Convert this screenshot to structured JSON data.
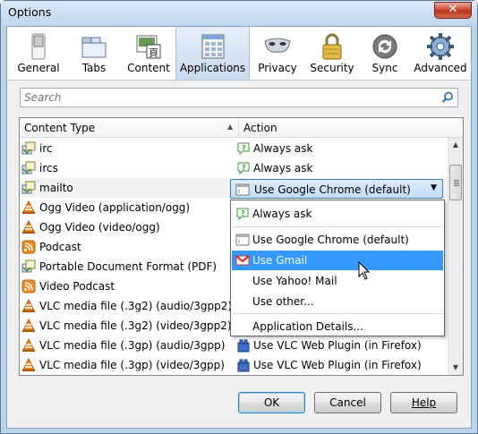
{
  "window": {
    "title": "Options",
    "close_glyph": "✕"
  },
  "toolbar": {
    "panes": [
      {
        "label": "General",
        "icon": "switch-icon"
      },
      {
        "label": "Tabs",
        "icon": "tabs-icon"
      },
      {
        "label": "Content",
        "icon": "content-icon"
      },
      {
        "label": "Applications",
        "icon": "applications-icon",
        "selected": true
      },
      {
        "label": "Privacy",
        "icon": "mask-icon"
      },
      {
        "label": "Security",
        "icon": "lock-icon"
      },
      {
        "label": "Sync",
        "icon": "sync-icon"
      },
      {
        "label": "Advanced",
        "icon": "gear-icon"
      }
    ]
  },
  "search": {
    "placeholder": "Search",
    "value": ""
  },
  "table": {
    "columns": {
      "content_type": "Content Type",
      "action": "Action",
      "sort_glyph": "▲"
    },
    "rows": [
      {
        "content_type": "irc",
        "ct_icon": "protocol-icon",
        "action": "Always ask",
        "ac_icon": "always-ask-icon"
      },
      {
        "content_type": "ircs",
        "ct_icon": "protocol-icon",
        "action": "Always ask",
        "ac_icon": "always-ask-icon"
      },
      {
        "content_type": "mailto",
        "ct_icon": "protocol-icon",
        "action": "Use Google Chrome (default)",
        "ac_icon": "app-window-icon",
        "selected": true
      },
      {
        "content_type": "Ogg Video (application/ogg)",
        "ct_icon": "vlc-cone-icon",
        "action": "",
        "ac_icon": ""
      },
      {
        "content_type": "Ogg Video (video/ogg)",
        "ct_icon": "vlc-cone-icon",
        "action": "",
        "ac_icon": ""
      },
      {
        "content_type": "Podcast",
        "ct_icon": "feed-icon",
        "action": "",
        "ac_icon": ""
      },
      {
        "content_type": "Portable Document Format (PDF)",
        "ct_icon": "protocol-icon",
        "action": "",
        "ac_icon": ""
      },
      {
        "content_type": "Video Podcast",
        "ct_icon": "feed-icon",
        "action": "",
        "ac_icon": ""
      },
      {
        "content_type": "VLC media file (.3g2) (audio/3gpp2)",
        "ct_icon": "vlc-cone-icon",
        "action": "",
        "ac_icon": ""
      },
      {
        "content_type": "VLC media file (.3g2) (video/3gpp2)",
        "ct_icon": "vlc-cone-icon",
        "action": "",
        "ac_icon": ""
      },
      {
        "content_type": "VLC media file (.3gp) (audio/3gpp)",
        "ct_icon": "vlc-cone-icon",
        "action": "Use VLC Web Plugin (in Firefox)",
        "ac_icon": "plugin-icon"
      },
      {
        "content_type": "VLC media file (.3gp) (video/3gpp)",
        "ct_icon": "vlc-cone-icon",
        "action": "Use VLC Web Plugin (in Firefox)",
        "ac_icon": "plugin-icon"
      }
    ]
  },
  "combo": {
    "value": "Use Google Chrome (default)",
    "arrow": "▼"
  },
  "dropdown": {
    "items": [
      {
        "label": "Always ask",
        "icon": "always-ask-icon"
      },
      {
        "label": "Use Google Chrome (default)",
        "icon": "app-window-icon"
      },
      {
        "label": "Use Gmail",
        "icon": "gmail-icon",
        "highlighted": true
      },
      {
        "label": "Use Yahoo! Mail",
        "icon": ""
      },
      {
        "label": "Use other...",
        "icon": ""
      },
      {
        "label": "Application Details...",
        "icon": ""
      }
    ]
  },
  "buttons": {
    "ok": "OK",
    "cancel": "Cancel",
    "help": "Help"
  },
  "colors": {
    "selection": "#3399ff",
    "titlebar": "#c0d6ee",
    "combo": "#c1dcfc"
  }
}
